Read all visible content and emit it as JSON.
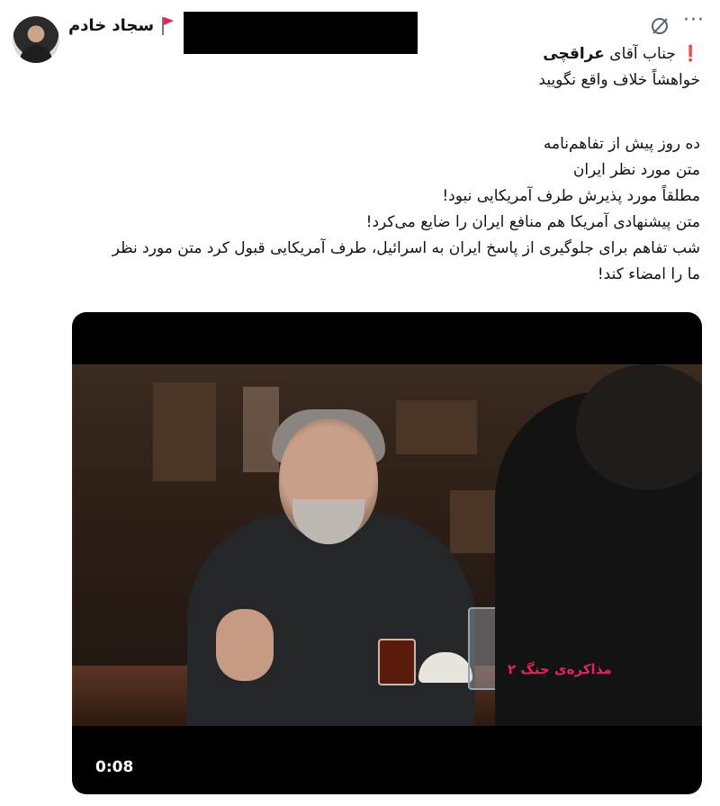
{
  "author": {
    "name": "سجاد خادم",
    "flag_color": "#e0245e",
    "avatar_icon": "profile-photo"
  },
  "header_icons": {
    "grok": "grok-icon",
    "more": "···"
  },
  "tweet": {
    "headline": {
      "line1_prefix": "جناب آقای",
      "line1_bold": "عراقچی",
      "line2": "خواهشاً خلاف واقع نگویید"
    },
    "body": [
      "ده روز پیش از تفاهم‌نامه",
      "متن مورد نظر ایران",
      "مطلقاً مورد پذیرش طرف آمریکایی نبود!",
      "متن پیشنهادی آمریکا هم منافع ایران را ضایع می‌کرد!",
      "شب تفاهم برای جلوگیری از پاسخ ایران به اسرائیل، طرف آمریکایی قبول کرد متن مورد نظر",
      "ما را امضاء کند!"
    ]
  },
  "video": {
    "duration": "0:08",
    "caption": "مذاکره‌ی جنگ ۲"
  }
}
